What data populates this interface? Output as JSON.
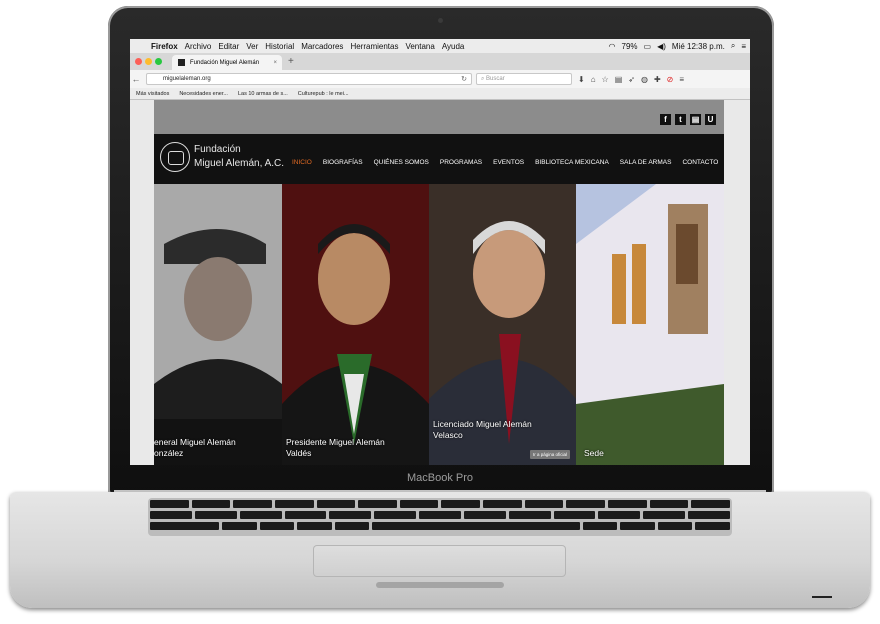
{
  "device": {
    "model_label": "MacBook Pro"
  },
  "menubar": {
    "app": "Firefox",
    "items": [
      "Archivo",
      "Editar",
      "Ver",
      "Historial",
      "Marcadores",
      "Herramientas",
      "Ventana",
      "Ayuda"
    ],
    "battery": "79%",
    "clock": "Mié 12:38 p.m."
  },
  "browser": {
    "tab_title": "Fundación Miguel Alemán",
    "url": "miguelaleman.org",
    "search_placeholder": "Buscar",
    "bookmarks": [
      "Más visitados",
      "Necesidades ener...",
      "Las 10 armas de s...",
      "Culturepub : le mei..."
    ]
  },
  "site": {
    "org_name_line1": "Fundación",
    "org_name_line2": "Miguel Alemán, A.C.",
    "social": [
      "f",
      "t",
      "▤",
      "U"
    ],
    "nav": [
      "INICIO",
      "BIOGRAFÍAS",
      "QUIÉNES SOMOS",
      "PROGRAMAS",
      "EVENTOS",
      "BIBLIOTECA MEXICANA",
      "SALA DE ARMAS",
      "CONTACTO"
    ],
    "panels": [
      {
        "line1": "eneral Miguel Alemán",
        "line2": "onzález"
      },
      {
        "line1": "Presidente Miguel Alemán",
        "line2": "Valdés"
      },
      {
        "line1": "Licenciado Miguel Alemán",
        "line2": "Velasco",
        "button": "Ir a página oficial"
      },
      {
        "line1": "Sede",
        "line2": ""
      }
    ]
  },
  "colors": {
    "accent": "#e06a24",
    "header_bg": "#111111"
  }
}
